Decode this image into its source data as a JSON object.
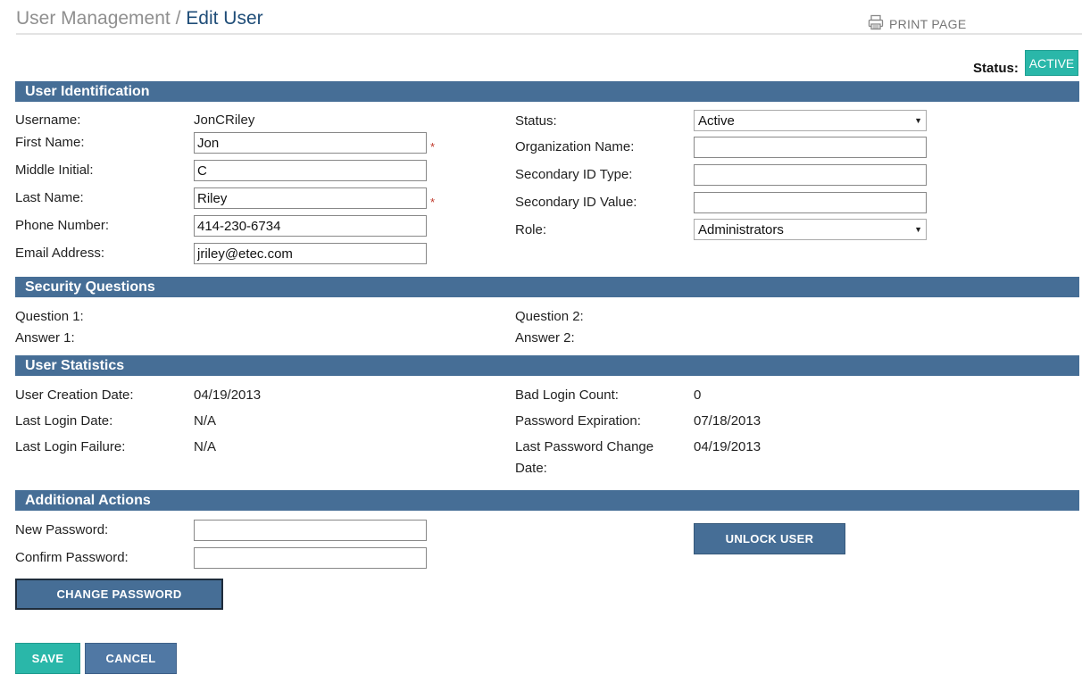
{
  "breadcrumb": {
    "parent": "User Management",
    "separator": "/",
    "current": "Edit User"
  },
  "print_label": "PRINT PAGE",
  "status_header": {
    "label": "Status:",
    "badge": "ACTIVE"
  },
  "sections": {
    "identification": "User Identification",
    "security": "Security Questions",
    "statistics": "User Statistics",
    "actions": "Additional Actions"
  },
  "identification": {
    "username_label": "Username:",
    "username_value": "JonCRiley",
    "first_name_label": "First Name:",
    "first_name_value": "Jon",
    "middle_initial_label": "Middle Initial:",
    "middle_initial_value": "C",
    "last_name_label": "Last Name:",
    "last_name_value": "Riley",
    "phone_label": "Phone Number:",
    "phone_value": "414-230-6734",
    "email_label": "Email Address:",
    "email_value": "jriley@etec.com",
    "status_label": "Status:",
    "status_value": "Active",
    "org_label": "Organization Name:",
    "org_value": "",
    "secondary_type_label": "Secondary ID Type:",
    "secondary_type_value": "",
    "secondary_value_label": "Secondary ID Value:",
    "secondary_value_value": "",
    "role_label": "Role:",
    "role_value": "Administrators",
    "required_marker": "*"
  },
  "security": {
    "q1_label": "Question 1:",
    "a1_label": "Answer 1:",
    "q2_label": "Question 2:",
    "a2_label": "Answer 2:"
  },
  "statistics": {
    "creation_label": "User Creation Date:",
    "creation_value": "04/19/2013",
    "last_login_label": "Last Login Date:",
    "last_login_value": "N/A",
    "last_failure_label": "Last Login Failure:",
    "last_failure_value": "N/A",
    "bad_login_label": "Bad Login Count:",
    "bad_login_value": "0",
    "pwd_exp_label": "Password Expiration:",
    "pwd_exp_value": "07/18/2013",
    "last_pwd_change_label_line1": "Last Password Change",
    "last_pwd_change_label_line2": "Date:",
    "last_pwd_change_value": "04/19/2013"
  },
  "actions": {
    "new_password_label": "New Password:",
    "new_password_value": "",
    "confirm_password_label": "Confirm Password:",
    "confirm_password_value": "",
    "change_password_button": "CHANGE PASSWORD",
    "unlock_button": "UNLOCK USER"
  },
  "footer": {
    "save_button": "SAVE",
    "cancel_button": "CANCEL"
  },
  "colors": {
    "section_header": "#466e96",
    "active_badge": "#2ab7a9",
    "required": "#c0392b",
    "breadcrumb_current": "#1f4d78"
  }
}
